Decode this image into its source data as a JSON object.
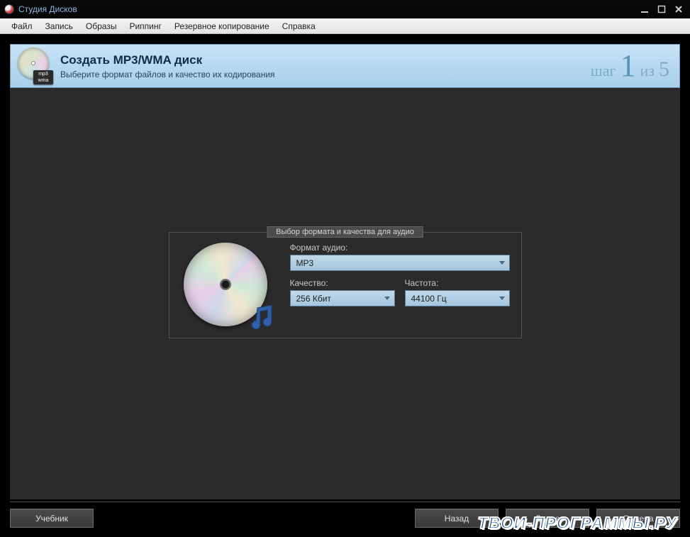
{
  "title": "Студия Дисков",
  "menu": {
    "file": "Файл",
    "record": "Запись",
    "images": "Образы",
    "ripping": "Риппинг",
    "backup": "Резервное копирование",
    "help": "Справка"
  },
  "step": {
    "icon_tag": "mp3\nwma",
    "title": "Создать MP3/WMA диск",
    "subtitle": "Выберите формат файлов и качество их кодирования",
    "word_step": "шаг",
    "current": "1",
    "word_of": "из",
    "total": "5"
  },
  "group": {
    "legend": "Выбор формата и качества для аудио",
    "format_label": "Формат аудио:",
    "format_value": "MP3",
    "quality_label": "Качество:",
    "quality_value": "256 Кбит",
    "freq_label": "Частота:",
    "freq_value": "44100 Гц"
  },
  "buttons": {
    "tutorial": "Учебник",
    "back": "Назад",
    "next": "Далее",
    "cancel": "Отмена"
  },
  "watermark": "ТВОИ-ПРОГРАММЫ.РУ"
}
